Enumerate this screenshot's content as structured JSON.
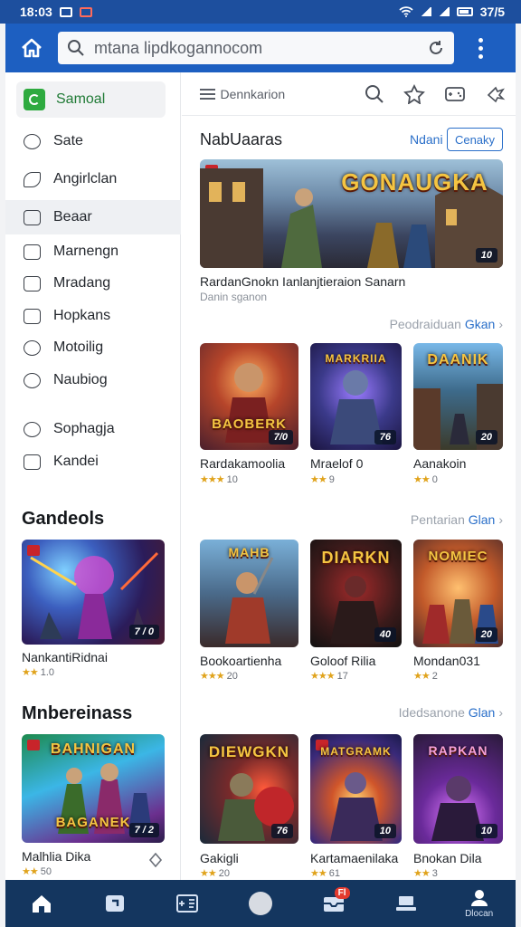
{
  "status_bar": {
    "time": "18:03",
    "battery": "37/5"
  },
  "browser": {
    "url": "mtana lipdkogannocom"
  },
  "sidebar": {
    "active_item": "Samoal",
    "items": [
      {
        "label": "Sate",
        "icon": "camera-icon"
      },
      {
        "label": "Angirlclan",
        "icon": "leaf-icon"
      },
      {
        "label": "Beaar",
        "icon": "sword-icon"
      },
      {
        "label": "Marnengn",
        "icon": "bag-icon"
      },
      {
        "label": "Mradang",
        "icon": "list-icon"
      },
      {
        "label": "Hopkans",
        "icon": "ticket-icon"
      },
      {
        "label": "Motoilig",
        "icon": "target-icon"
      },
      {
        "label": "Naubiog",
        "icon": "search-icon"
      },
      {
        "label": "Sophagja",
        "icon": "timer-icon"
      },
      {
        "label": "Kandei",
        "icon": "badge-icon"
      }
    ],
    "section_1": {
      "title": "Gandeols",
      "card": {
        "title": "NankantiRidnai",
        "rating": "1.0",
        "badge": "7 / 0"
      }
    },
    "section_2": {
      "title": "Mnbereinass",
      "card": {
        "title": "Malhlia Dika",
        "rating": "50",
        "badge": "7 / 2",
        "art": "BAGANEK"
      }
    }
  },
  "toolbar": {
    "label": "Dennkarion"
  },
  "featured": {
    "title": "NabUaaras",
    "more_label": "Ndani",
    "button_label": "Cenaky",
    "banner_art": "GONAUGKA",
    "banner_badge": "10",
    "caption": "RardanGnokn Ianlanjtieraion Sanarn",
    "subcaption": "Danin sganon"
  },
  "rows": [
    {
      "see_all_prefix": "Peodraiduan",
      "see_all_link": "Gkan",
      "cards": [
        {
          "title": "Rardakamoolia",
          "rating": "10",
          "badge": "7/0",
          "art": "BAOBERK"
        },
        {
          "title": "Mraelof 0",
          "rating": "9",
          "badge": "76",
          "art": "MARKRIIA"
        },
        {
          "title": "Aanakoin",
          "rating": "0",
          "badge": "20",
          "art": "DAANIK"
        }
      ]
    },
    {
      "see_all_prefix": "Pentarian",
      "see_all_link": "Glan",
      "cards": [
        {
          "title": "Bookoartienha",
          "rating": "20",
          "badge": "",
          "art": "MAHB"
        },
        {
          "title": "Goloof Rilia",
          "rating": "17",
          "badge": "40",
          "art": "DIARKN"
        },
        {
          "title": "Mondan031",
          "rating": "2",
          "badge": "20",
          "art": "NOMIEC"
        }
      ]
    },
    {
      "see_all_prefix": "Idedsanone",
      "see_all_link": "Glan",
      "cards": [
        {
          "title": "Gakigli",
          "rating": "20",
          "badge": "76",
          "art": "DIEWGKN"
        },
        {
          "title": "Kartamaenilaka",
          "rating": "61",
          "badge": "10",
          "art": "MATGRAMK"
        },
        {
          "title": "Bnokan Dila",
          "rating": "3",
          "badge": "10",
          "art": "RAPKAN"
        }
      ]
    }
  ],
  "bottom_nav": {
    "items": [
      {
        "icon": "home-icon",
        "label": ""
      },
      {
        "icon": "image-icon",
        "label": ""
      },
      {
        "icon": "gamepad-icon",
        "label": ""
      },
      {
        "icon": "circle-icon",
        "label": ""
      },
      {
        "icon": "inbox-icon",
        "label": "",
        "badge": "Fl"
      },
      {
        "icon": "laptop-icon",
        "label": ""
      },
      {
        "icon": "profile-icon",
        "label": "Dlocan"
      }
    ]
  },
  "colors": {
    "app_bar": "#1d5fc1",
    "status_bar": "#1d4f9e",
    "bottom_nav": "#14365f",
    "accent": "#2a6fc9",
    "active_green": "#2eaa3f",
    "star": "#e0a31c"
  }
}
